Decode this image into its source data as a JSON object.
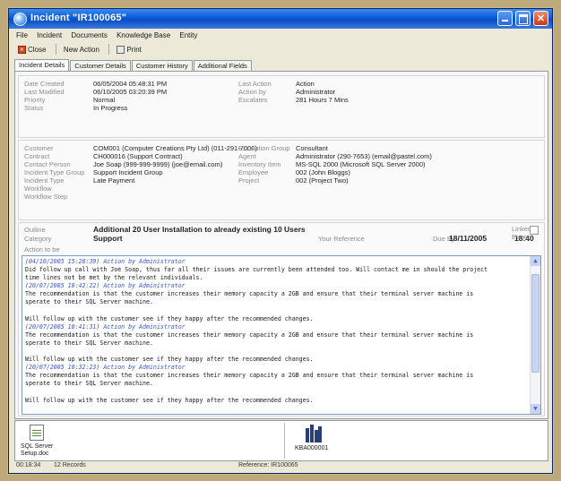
{
  "window": {
    "title": "Incident \"IR100065\""
  },
  "menu": [
    "File",
    "Incident",
    "Documents",
    "Knowledge Base",
    "Entity"
  ],
  "toolbar": {
    "close": "Close",
    "new_action": "New Action",
    "print": "Print"
  },
  "tabs": [
    "Incident Details",
    "Customer Details",
    "Customer History",
    "Additional Fields"
  ],
  "section1": {
    "date_created_label": "Date Created",
    "date_created": "06/05/2004 05:48:31 PM",
    "last_modified_label": "Last Modified",
    "last_modified": "06/10/2005 03:20:39 PM",
    "priority_label": "Priority",
    "priority": "Normal",
    "status_label": "Status",
    "status": "In Progress",
    "last_action_label": "Last Action",
    "last_action": "Action",
    "action_by_label": "Action by",
    "action_by": "Administrator",
    "escalates_label": "Escalates",
    "escalates": "281 Hours 7 Mins"
  },
  "section2": {
    "customer_label": "Customer",
    "customer": "COM001 (Computer Creations Pty Ltd) (011-291-7000)",
    "contract_label": "Contract",
    "contract": "CH000016 (Support Contract)",
    "contact_label": "Contact Person",
    "contact": "Joe Soap (999-999-9999) (joe@email.com)",
    "itg_label": "Incident Type Group",
    "itg": "Support Incident Group",
    "it_label": "Incident Type",
    "it": "Late Payment",
    "workflow_label": "Workflow",
    "workflow_step_label": "Workflow Step",
    "esc_group_label": "Escalation Group",
    "esc_group": "Consultant",
    "agent_label": "Agent",
    "agent": "Administrator (290-7653) (email@pastel.com)",
    "inventory_label": "Inventory Item",
    "inventory": "MS-SQL 2000 (Microsoft SQL Server 2000)",
    "employee_label": "Employee",
    "employee": "002 (John Bloggs)",
    "project_label": "Project",
    "project": "002 (Project Two)"
  },
  "section3": {
    "outline_label": "Outline",
    "outline": "Additional 20 User Installation to already existing 10 Users",
    "category_label": "Category",
    "category": "Support",
    "your_ref_label": "Your Reference",
    "due_by_label": "Due By",
    "due_date": "18/11/2005",
    "due_time": "18:40",
    "linked_event_label": "Linked Event",
    "action_to_be_label": "Action to be"
  },
  "actions": [
    {
      "type": "hdr",
      "text": "(04/10/2005 15:20:39) Action by Administrator"
    },
    {
      "type": "txt",
      "text": "Did follow up call with Joe Soap, thus far all their issues are currently been attended too. Will contact me in should the project"
    },
    {
      "type": "txt",
      "text": "time lines not be met by the relevant individuals."
    },
    {
      "type": "hdr",
      "text": "(20/07/2005 10:42:22) Action by Administrator"
    },
    {
      "type": "txt",
      "text": "The recommendation is that the customer increases their memory capacity a 2GB and ensure that their terminal server machine is"
    },
    {
      "type": "txt",
      "text": "sperate to their SQL Server machine."
    },
    {
      "type": "blank",
      "text": ""
    },
    {
      "type": "txt",
      "text": "Will follow up with the customer see if they happy after the recommended changes."
    },
    {
      "type": "hdr",
      "text": "(20/07/2005 10:41:31) Action by Administrator"
    },
    {
      "type": "txt",
      "text": "The recommendation is that the customer increases their memory capacity a 2GB and ensure that their terminal server machine is"
    },
    {
      "type": "txt",
      "text": "sperate to their SQL Server machine."
    },
    {
      "type": "blank",
      "text": ""
    },
    {
      "type": "txt",
      "text": "Will follow up with the customer see if they happy after the recommended changes."
    },
    {
      "type": "hdr",
      "text": "(20/07/2005 10:32:23) Action by Administrator"
    },
    {
      "type": "txt",
      "text": "The recommendation is that the customer increases their memory capacity a 2GB and ensure that their terminal server machine is"
    },
    {
      "type": "txt",
      "text": "sperate to their SQL Server machine."
    },
    {
      "type": "blank",
      "text": ""
    },
    {
      "type": "txt",
      "text": "Will follow up with the customer see if they happy after the recommended changes."
    }
  ],
  "attachments": [
    {
      "name": "SQL Server Setup.doc",
      "line1": "SQL Server",
      "line2": "Setup.doc",
      "icon": "word-document-icon"
    },
    {
      "name": "KBA000001",
      "line1": "KBA000001",
      "line2": "",
      "icon": "knowledge-base-icon"
    }
  ],
  "status": {
    "time": "00:18:34",
    "records": "12 Records",
    "reference": "Reference: IR100065"
  },
  "colors": {
    "title_bar": "#0a4cc4",
    "action_header": "#3a56c9",
    "background": "#bda97a"
  }
}
